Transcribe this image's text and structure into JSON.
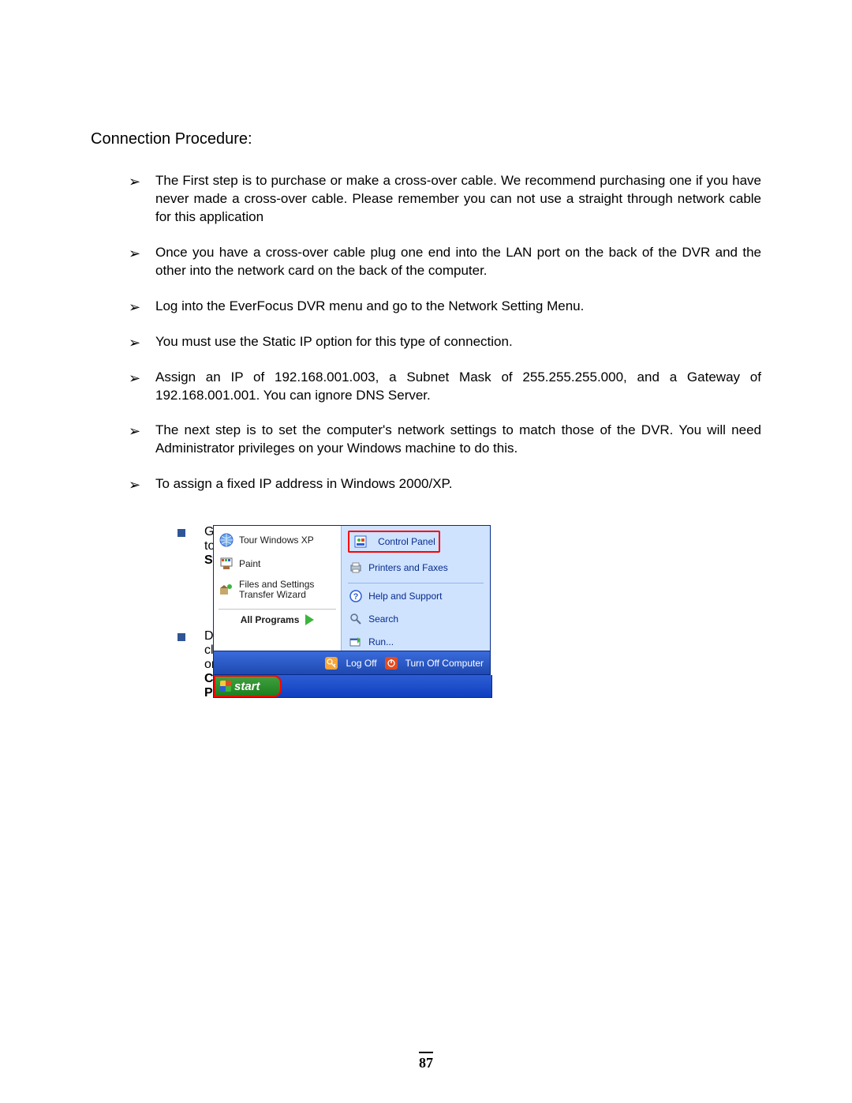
{
  "texts": {
    "heading": "Connection Procedure:",
    "bullets": [
      "The First step is to purchase or make a cross-over cable. We recommend purchasing one if you have never made a cross-over cable. Please remember you can not use a straight through network cable for this application",
      "Once you have a cross-over cable plug one end into the LAN port on the back of the DVR and the other into the network card on the back of the computer.",
      "Log into the EverFocus DVR menu and go to the Network Setting Menu.",
      "You must use the Static IP option for this type of connection.",
      "Assign an IP of 192.168.001.003, a Subnet Mask of 255.255.255.000, and a Gateway of 192.168.001.001. You can ignore DNS Server.",
      "The next step is to set the computer's network settings to match those of the DVR. You will need Administrator privileges on your Windows machine to do this.",
      "To assign a fixed IP address in Windows 2000/XP."
    ],
    "instr1_pre": "Go to ",
    "instr1_bold": "Start",
    "instr2_pre": "Double-click on ",
    "instr2_bold": "Control Panel",
    "xp_left_items": [
      "Tour Windows XP",
      "Paint",
      "Files and Settings Transfer Wizard"
    ],
    "all_programs": "All Programs",
    "xp_right_items": [
      "Control Panel",
      "Printers and Faxes",
      "Help and Support",
      "Search",
      "Run..."
    ],
    "logoff": "Log Off",
    "turnoff": "Turn Off Computer",
    "start": "start",
    "page_number": "87"
  }
}
